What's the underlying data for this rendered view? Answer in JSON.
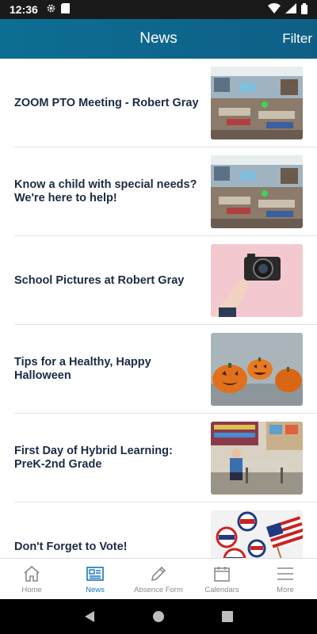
{
  "status_bar": {
    "time": "12:36",
    "icons_left": [
      "gear-icon",
      "sim-icon"
    ],
    "icons_right": [
      "wifi-icon",
      "signal-icon",
      "battery-icon"
    ]
  },
  "header": {
    "title": "News",
    "filter_label": "Filter",
    "gradient_colors": [
      "#0d6e94",
      "#0e5f86"
    ]
  },
  "news": [
    {
      "title": "ZOOM PTO Meeting - Robert Gray",
      "image": "classroom-photo"
    },
    {
      "title": "Know a child with special needs? We're here to help!",
      "image": "classroom-photo"
    },
    {
      "title": "School Pictures at Robert Gray",
      "image": "camera-photo"
    },
    {
      "title": "Tips for a Healthy, Happy Halloween",
      "image": "pumpkins-photo"
    },
    {
      "title": "First Day of Hybrid Learning: PreK-2nd Grade",
      "image": "student-desk-photo"
    },
    {
      "title": "Don't Forget to Vote!",
      "image": "vote-buttons-photo"
    }
  ],
  "bottom_nav": {
    "items": [
      {
        "label": "Home",
        "icon": "home-icon",
        "active": false
      },
      {
        "label": "News",
        "icon": "news-icon",
        "active": true
      },
      {
        "label": "Absence Form",
        "icon": "pencil-icon",
        "active": false
      },
      {
        "label": "Calendars",
        "icon": "calendar-icon",
        "active": false
      },
      {
        "label": "More",
        "icon": "menu-icon",
        "active": false
      }
    ],
    "active_color": "#1576b8"
  },
  "system_nav": [
    "back-icon",
    "home-circle-icon",
    "recents-icon"
  ]
}
